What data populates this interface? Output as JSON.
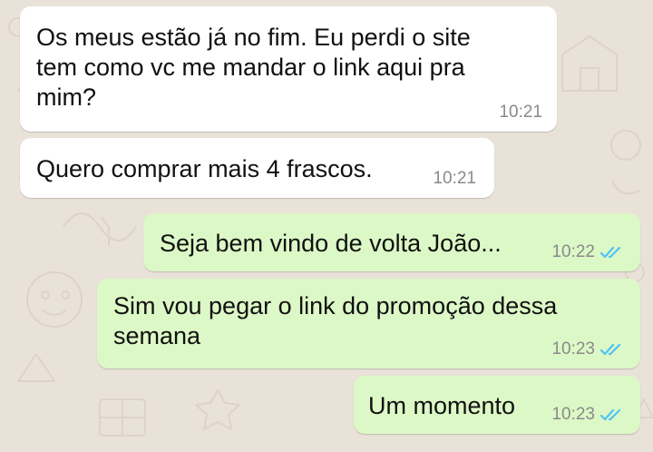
{
  "chat": {
    "messages": [
      {
        "direction": "incoming",
        "text": "Os meus estão já no fim. Eu perdi o site\ntem como vc me mandar o link aqui pra\nmim?",
        "time": "10:21"
      },
      {
        "direction": "incoming",
        "text": "Quero comprar mais 4 frascos.",
        "time": "10:21"
      },
      {
        "direction": "outgoing",
        "text": "Seja bem vindo de volta João...",
        "time": "10:22",
        "status_icon": "double-check-read-icon"
      },
      {
        "direction": "outgoing",
        "text": "Sim vou pegar o link do promoção dessa\nsemana",
        "time": "10:23",
        "status_icon": "double-check-read-icon"
      },
      {
        "direction": "outgoing",
        "text": "Um momento",
        "time": "10:23",
        "status_icon": "double-check-read-icon"
      }
    ]
  },
  "colors": {
    "wallpaper": "#e9e2d8",
    "incoming_bubble": "#ffffff",
    "outgoing_bubble": "#dcf8c6",
    "read_ticks": "#4fc3f7",
    "timestamp": "#8a8a8a"
  }
}
